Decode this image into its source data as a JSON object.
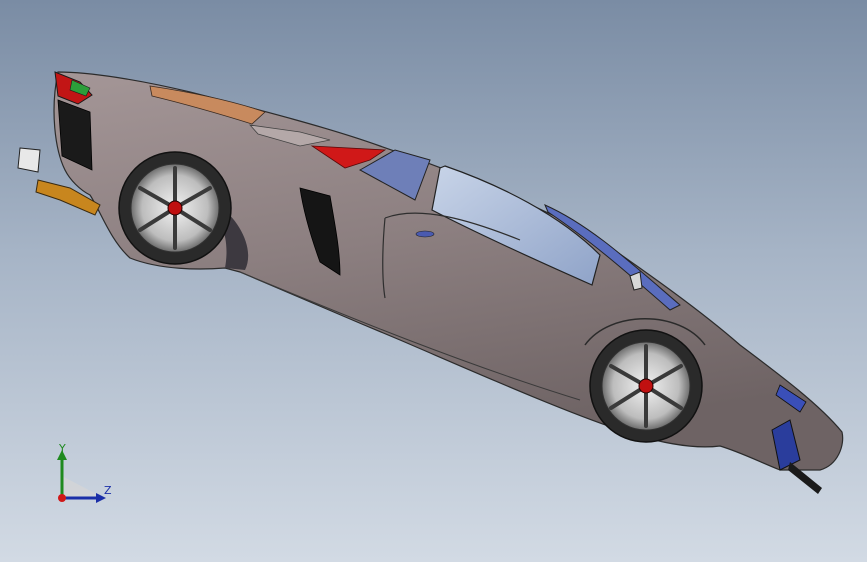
{
  "viewport": {
    "background_top": "#7a8ca4",
    "background_bottom": "#d2dae4"
  },
  "model": {
    "subject": "sports-car",
    "body_color": "#8c7f80",
    "roof_color": "#c88a5e",
    "window_color": "#9ab0d4",
    "taillight_color": "#d01818",
    "wheel_hub_color": "#c01010",
    "rear_diffuser_color": "#c8861e",
    "front_intake_color": "#2a3d9c"
  },
  "triad": {
    "y_label": "Y",
    "z_label": "Z",
    "y_color": "#1f8a1f",
    "z_color": "#1b2fa8",
    "x_color": "#d01818"
  }
}
